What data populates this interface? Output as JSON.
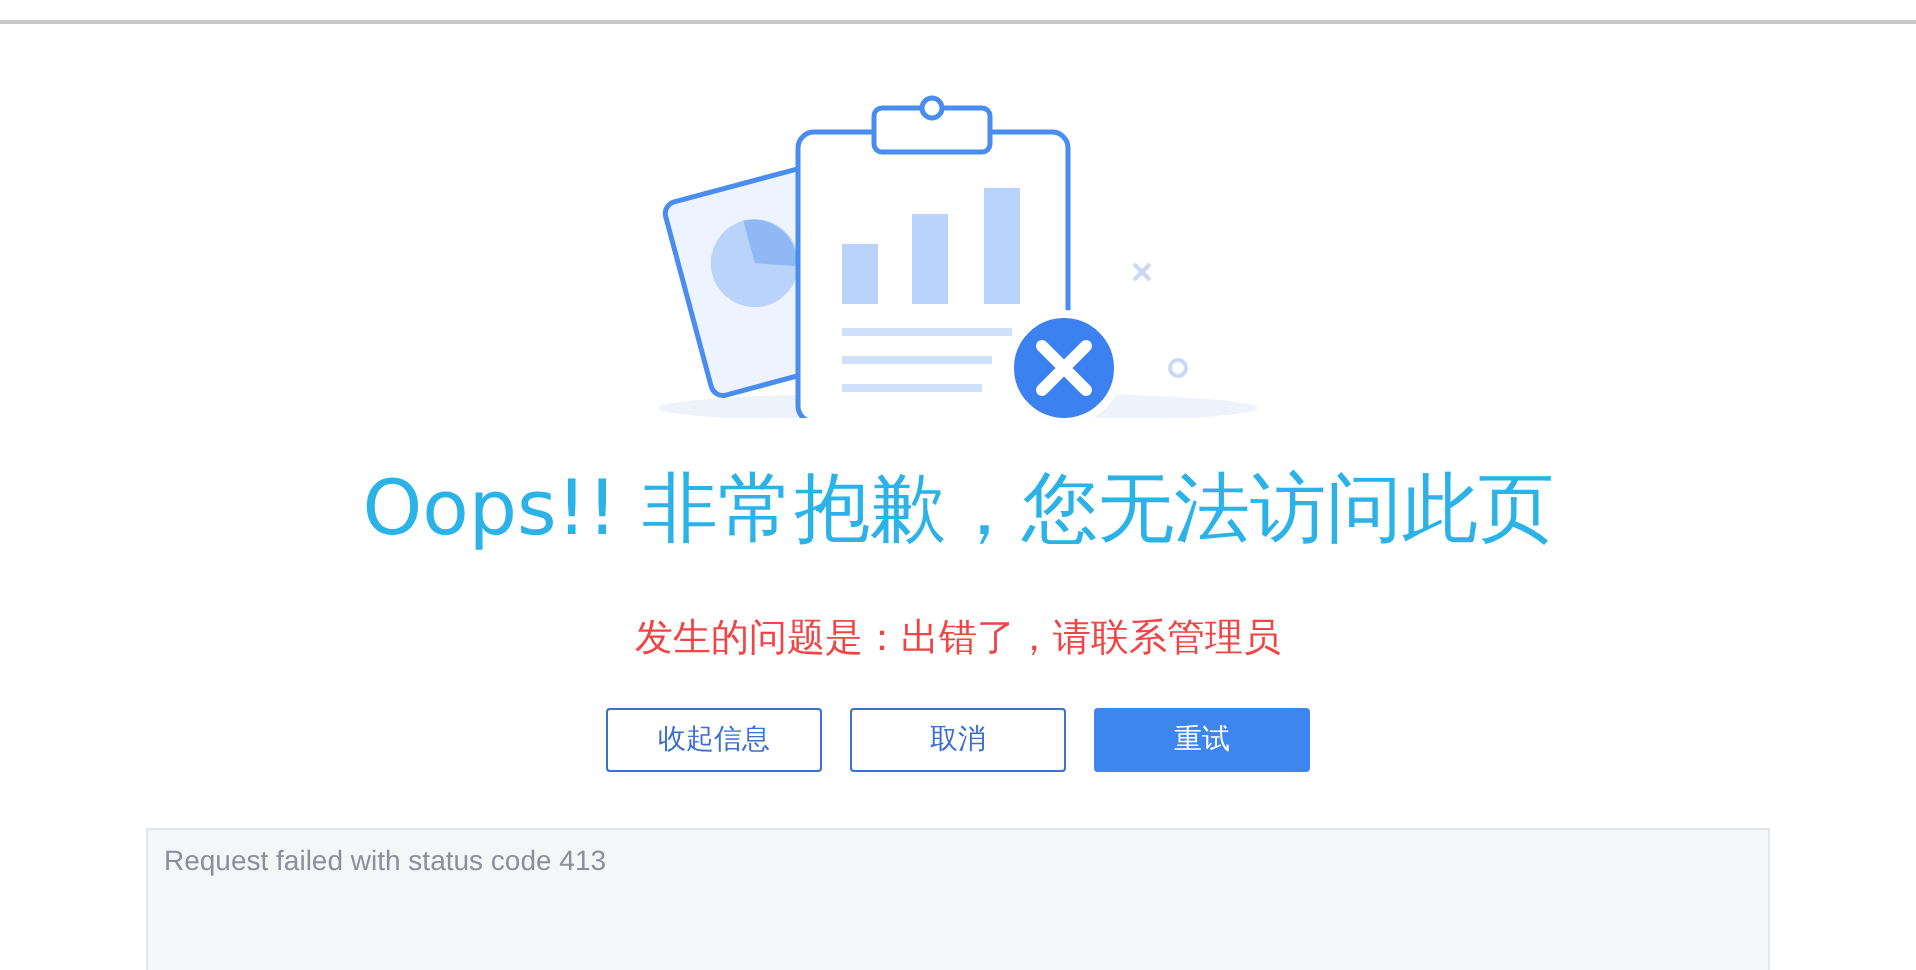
{
  "title": "Oops!!  非常抱歉，您无法访问此页",
  "message": "发生的问题是：出错了，请联系管理员",
  "buttons": [
    {
      "label": "收起信息",
      "kind": "outline"
    },
    {
      "label": "取消",
      "kind": "outline"
    },
    {
      "label": "重试",
      "kind": "primary"
    }
  ],
  "details": {
    "expanded": true,
    "text": "Request failed with status code 413"
  }
}
